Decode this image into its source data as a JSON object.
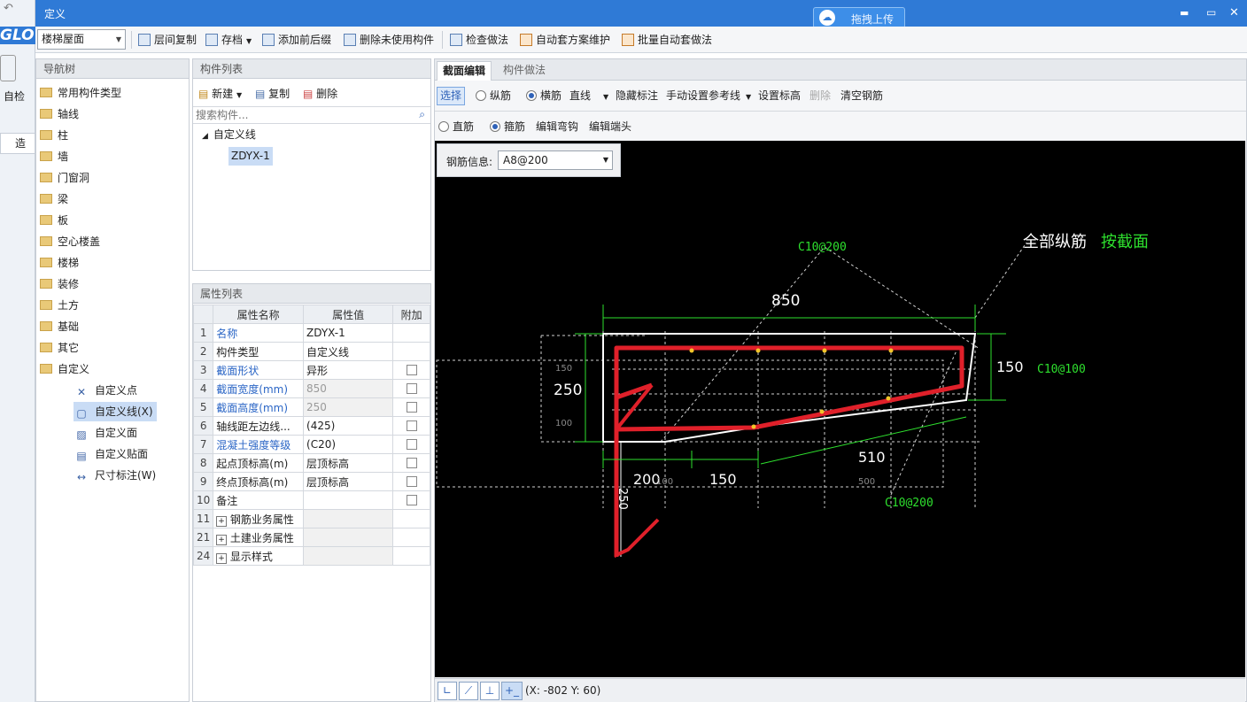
{
  "window": {
    "title": "定义",
    "upload_label": "拖拽上传",
    "min": "▬",
    "max": "▭",
    "close": "✕"
  },
  "left_strip": {
    "logo": "GLO",
    "check_label": "自检",
    "tab": "造价"
  },
  "toolbar": {
    "floor_select": "楼梯屋面",
    "items": [
      "层间复制",
      "存档",
      "添加前后缀",
      "删除未使用构件",
      "检查做法",
      "自动套方案维护",
      "批量自动套做法"
    ]
  },
  "nav_tree": {
    "header": "导航树",
    "items": [
      "常用构件类型",
      "轴线",
      "柱",
      "墙",
      "门窗洞",
      "梁",
      "板",
      "空心楼盖",
      "楼梯",
      "装修",
      "土方",
      "基础",
      "其它",
      "自定义"
    ],
    "sub_items": [
      "自定义点",
      "自定义线(X)",
      "自定义面",
      "自定义贴面",
      "尺寸标注(W)"
    ]
  },
  "component_list": {
    "header": "构件列表",
    "new_label": "新建",
    "copy_label": "复制",
    "delete_label": "删除",
    "search_placeholder": "搜索构件...",
    "group": "自定义线",
    "item": "ZDYX-1"
  },
  "properties": {
    "header": "属性列表",
    "col_name": "属性名称",
    "col_value": "属性值",
    "col_extra": "附加",
    "rows": [
      {
        "no": "1",
        "name": "名称",
        "value": "ZDYX-1"
      },
      {
        "no": "2",
        "name": "构件类型",
        "value": "自定义线"
      },
      {
        "no": "3",
        "name": "截面形状",
        "value": "异形"
      },
      {
        "no": "4",
        "name": "截面宽度(mm)",
        "value": "850"
      },
      {
        "no": "5",
        "name": "截面高度(mm)",
        "value": "250"
      },
      {
        "no": "6",
        "name": "轴线距左边线...",
        "value": "(425)"
      },
      {
        "no": "7",
        "name": "混凝土强度等级",
        "value": "(C20)"
      },
      {
        "no": "8",
        "name": "起点顶标高(m)",
        "value": "层顶标高"
      },
      {
        "no": "9",
        "name": "终点顶标高(m)",
        "value": "层顶标高"
      },
      {
        "no": "10",
        "name": "备注",
        "value": ""
      },
      {
        "no": "11",
        "name": "钢筋业务属性",
        "value": ""
      },
      {
        "no": "21",
        "name": "土建业务属性",
        "value": ""
      },
      {
        "no": "24",
        "name": "显示样式",
        "value": ""
      }
    ]
  },
  "editor": {
    "tabs": [
      "截面编辑",
      "构件做法"
    ],
    "row1": {
      "select": "选择",
      "longitudinal": "纵筋",
      "transverse": "横筋",
      "line_mode": "直线",
      "hide_label": "隐藏标注",
      "manual_ref": "手动设置参考线",
      "set_elev": "设置标高",
      "delete": "删除",
      "clear_rebar": "清空钢筋"
    },
    "row2": {
      "straight": "直筋",
      "stirrup": "箍筋",
      "edit_hook": "编辑弯钩",
      "edit_end": "编辑端头"
    },
    "rebar_info_label": "钢筋信息:",
    "rebar_info_value": "A8@200"
  },
  "drawing": {
    "all_long": "全部纵筋",
    "by_section": "按截面",
    "lbl_c10_200_top": "C10@200",
    "lbl_c10_100": "C10@100",
    "lbl_c10_200_bot": "C10@200",
    "dim_850": "850",
    "dim_250": "250",
    "dim_150_right": "150",
    "dim_510": "510",
    "dim_200": "200",
    "dim_150_bot": "150",
    "dim_250_v": "250",
    "small_150": "150",
    "small_100": "100",
    "small_100b": "100",
    "small_500": "500"
  },
  "statusbar": {
    "coords": "(X: -802 Y: 60)"
  },
  "colors": {
    "title_bar": "#2f7ad6",
    "canvas": "#000000",
    "rebar": "#e0202a",
    "dims": "#2ee02e"
  }
}
